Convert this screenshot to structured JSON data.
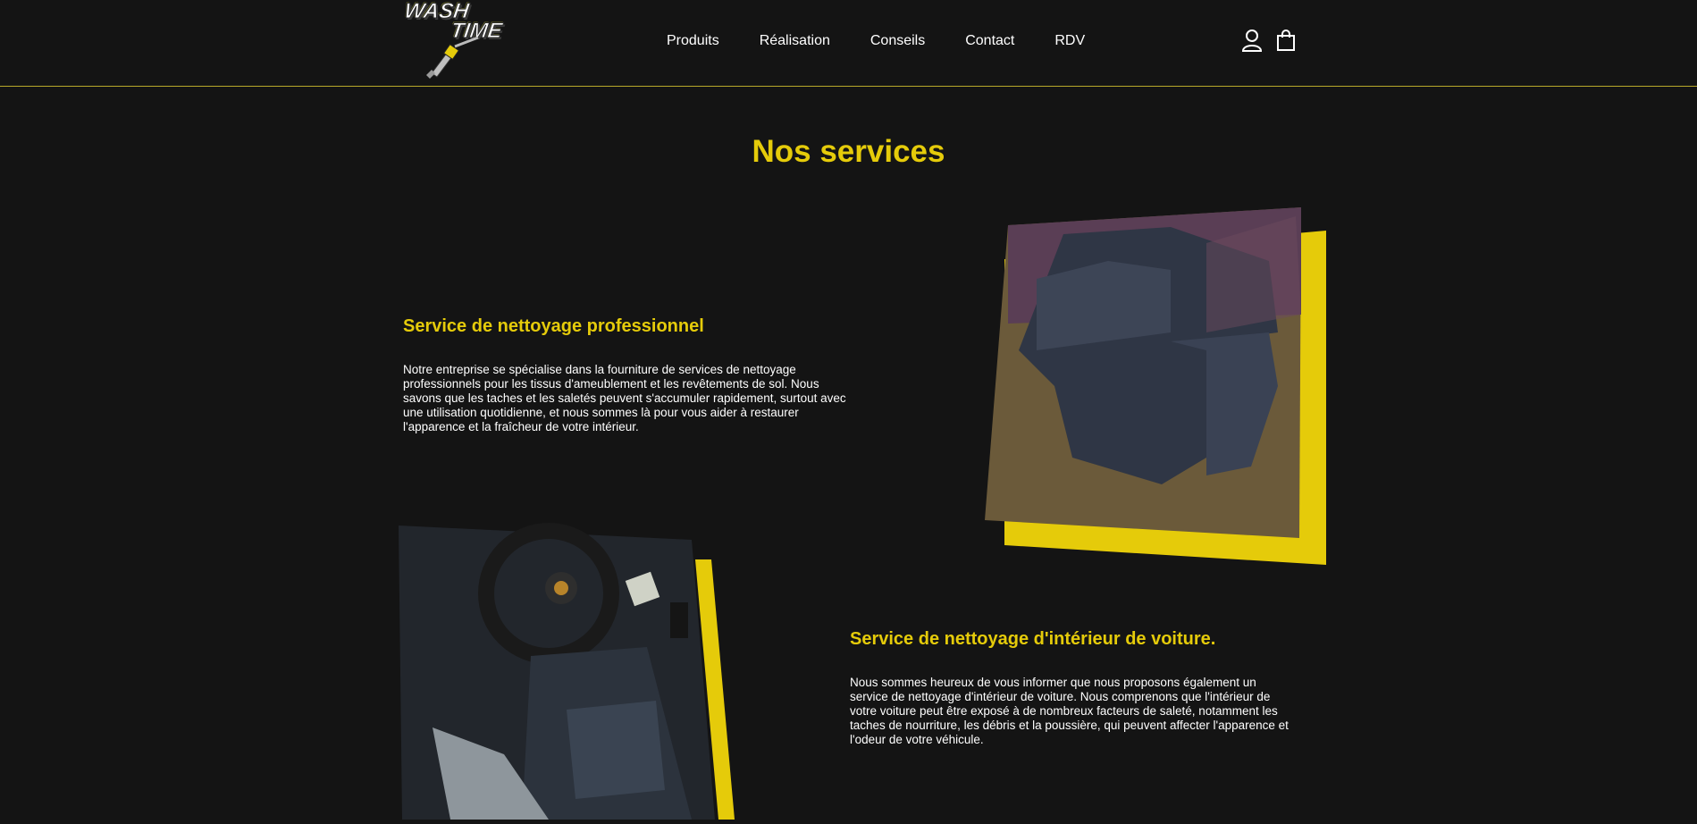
{
  "header": {
    "logo_line1": "WASH",
    "logo_line2": "TIME",
    "nav": [
      "Produits",
      "Réalisation",
      "Conseils",
      "Contact",
      "RDV"
    ],
    "icons": [
      "user-icon",
      "shopping-bag-icon"
    ]
  },
  "main": {
    "title": "Nos services",
    "sections": [
      {
        "title": "Service de nettoyage professionnel",
        "text": "Notre entreprise se spécialise dans la fourniture de services de nettoyage professionnels pour les tissus d'ameublement et les revêtements de sol. Nous savons que les taches et les saletés peuvent s'accumuler rapidement, surtout avec une utilisation quotidienne, et nous sommes là pour vous aider à restaurer l'apparence et la fraîcheur de votre intérieur."
      },
      {
        "title": "Service de nettoyage d'intérieur de voiture.",
        "text": "Nous sommes heureux de vous informer que nous proposons également un service de nettoyage d'intérieur de voiture. Nous comprenons que l'intérieur de votre voiture peut être exposé à de nombreux facteurs de saleté, notamment les taches de nourriture, les débris et la poussière, qui peuvent affecter l'apparence et l'odeur de votre véhicule."
      }
    ]
  },
  "colors": {
    "accent": "#e5cb0a",
    "background": "#141414",
    "text": "#ffffff",
    "header_border": "#b8a92a"
  }
}
